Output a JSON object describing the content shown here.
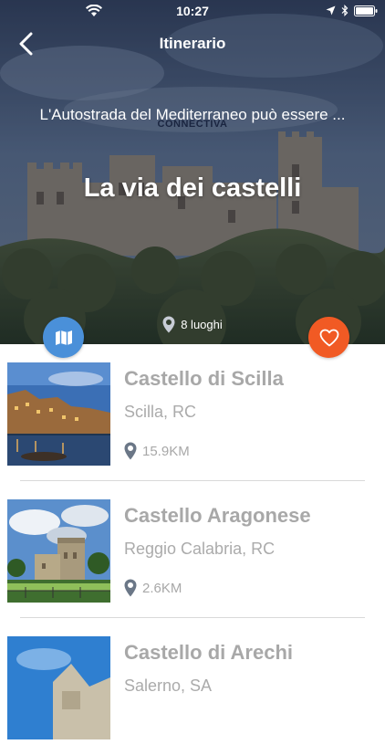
{
  "status_bar": {
    "time": "10:27"
  },
  "nav": {
    "title": "Itinerario"
  },
  "hero": {
    "subtitle": "L'Autostrada del Mediterraneo può essere ...",
    "brand": "CONNECTIVA",
    "title": "La via dei castelli",
    "places_label": "8 luoghi"
  },
  "colors": {
    "map_button": "#4a90d9",
    "favorite_button": "#f15a24",
    "text_gray": "#a8a8a8"
  },
  "items": [
    {
      "name": "Castello di Scilla",
      "location": "Scilla, RC",
      "distance": "15.9KM"
    },
    {
      "name": "Castello Aragonese",
      "location": "Reggio Calabria, RC",
      "distance": "2.6KM"
    },
    {
      "name": "Castello di Arechi",
      "location": "Salerno, SA",
      "distance": ""
    }
  ]
}
